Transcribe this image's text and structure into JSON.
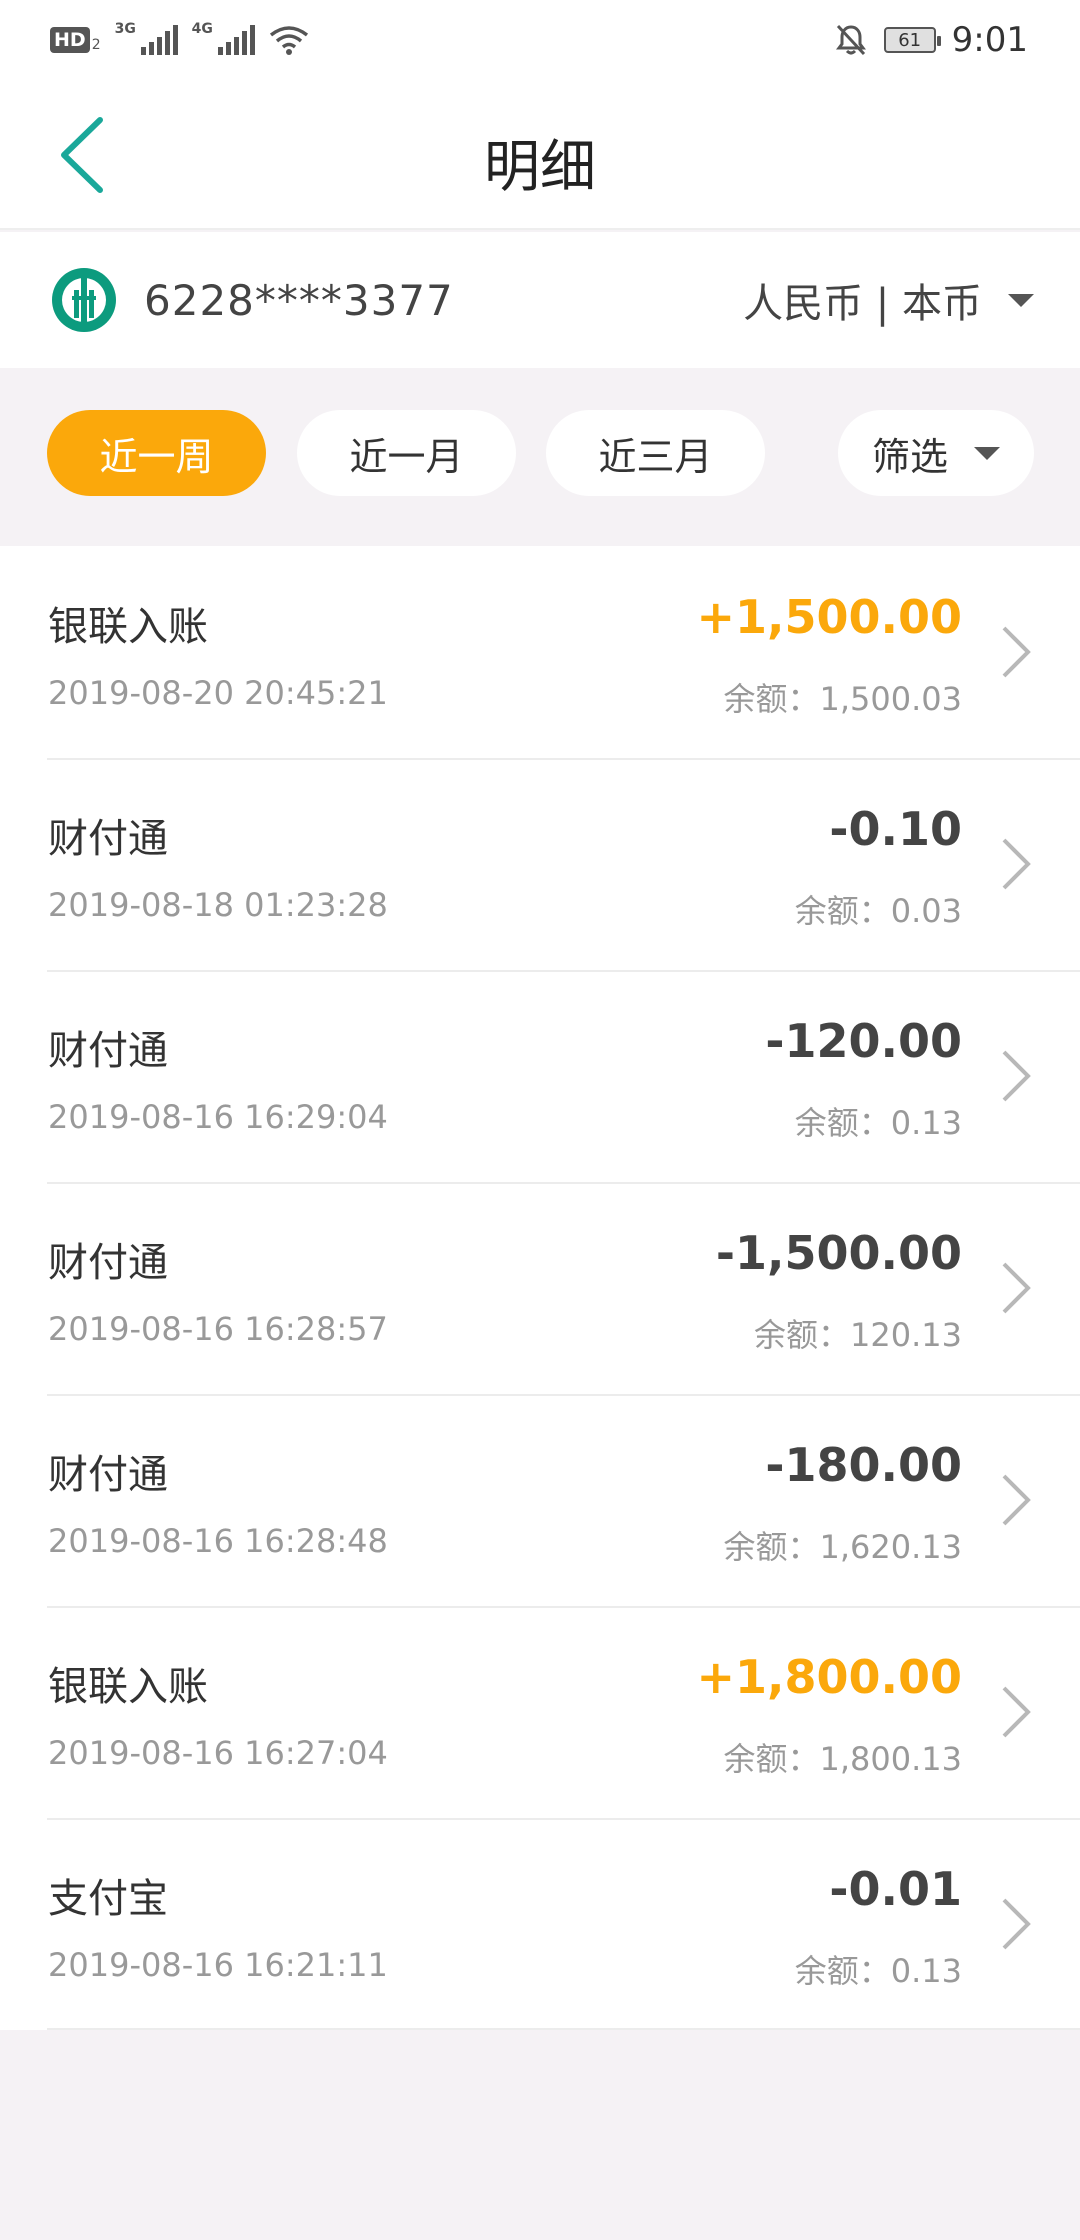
{
  "status_bar": {
    "hd_label": "HD",
    "hd_sub": "2",
    "net1": "3G",
    "net2": "4G",
    "battery": "61",
    "time": "9:01"
  },
  "header": {
    "title": "明细",
    "back_icon": "chevron-left-icon",
    "accent_color": "#1aa89a"
  },
  "account": {
    "number": "6228****3377",
    "currency": "人民币 | 本币",
    "logo_icon": "bank-logo-icon"
  },
  "filters": {
    "tabs": [
      "近一周",
      "近一月",
      "近三月"
    ],
    "active_index": 0,
    "filter_label": "筛选",
    "active_color": "#fba80b"
  },
  "transactions": [
    {
      "title": "银联入账",
      "time": "2019-08-20 20:45:21",
      "amount": "+1,500.00",
      "balance": "余额：1,500.03",
      "type": "income"
    },
    {
      "title": "财付通",
      "time": "2019-08-18 01:23:28",
      "amount": "-0.10",
      "balance": "余额：0.03",
      "type": "expense"
    },
    {
      "title": "财付通",
      "time": "2019-08-16 16:29:04",
      "amount": "-120.00",
      "balance": "余额：0.13",
      "type": "expense"
    },
    {
      "title": "财付通",
      "time": "2019-08-16 16:28:57",
      "amount": "-1,500.00",
      "balance": "余额：120.13",
      "type": "expense"
    },
    {
      "title": "财付通",
      "time": "2019-08-16 16:28:48",
      "amount": "-180.00",
      "balance": "余额：1,620.13",
      "type": "expense"
    },
    {
      "title": "银联入账",
      "time": "2019-08-16 16:27:04",
      "amount": "+1,800.00",
      "balance": "余额：1,800.13",
      "type": "income"
    },
    {
      "title": "支付宝",
      "time": "2019-08-16 16:21:11",
      "amount": "-0.01",
      "balance": "余额：0.13",
      "type": "expense"
    }
  ]
}
